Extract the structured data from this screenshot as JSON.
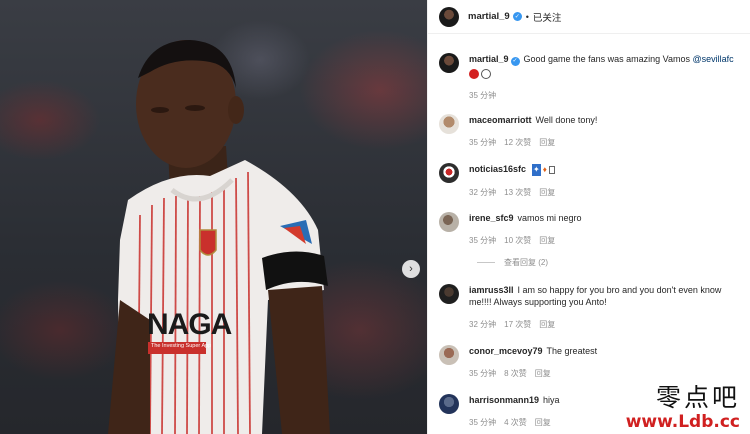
{
  "header": {
    "username": "martial_9",
    "separator": "•",
    "follow_status": "已关注"
  },
  "caption": {
    "username": "martial_9",
    "text": "Good game the fans was amazing Vamos",
    "mention": "@sevillafc",
    "time": "35 分钟"
  },
  "comments": [
    {
      "username": "maceomarriott",
      "text": "Well done tony!",
      "time": "35 分钟",
      "likes": "12 次赞",
      "reply": "回复"
    },
    {
      "username": "noticias16sfc",
      "text": "",
      "time": "32 分钟",
      "likes": "13 次赞",
      "reply": "回复"
    },
    {
      "username": "irene_sfc9",
      "text": "vamos mi negro",
      "time": "35 分钟",
      "likes": "10 次赞",
      "reply": "回复"
    },
    {
      "username": "iamruss3ll",
      "text": "I am so happy for you bro and you don't even know me!!!! Always supporting you Anto!",
      "time": "32 分钟",
      "likes": "17 次赞",
      "reply": "回复"
    },
    {
      "username": "conor_mcevoy79",
      "text": "The greatest",
      "time": "35 分钟",
      "likes": "8 次赞",
      "reply": "回复"
    },
    {
      "username": "harrisonmann19",
      "text": "hiya",
      "time": "35 分钟",
      "likes": "4 次赞",
      "reply": "回复"
    }
  ],
  "view_replies": "查看回复 (2)",
  "photo": {
    "sponsor": "NAGA",
    "sponsor_tagline": "The Investing Super App"
  },
  "watermark": {
    "chinese": "零点吧",
    "url": "www.Ldb.cc"
  },
  "colors": {
    "verified": "#3897f0",
    "link": "#00376b",
    "meta": "#8e8e8e",
    "watermark_url": "#d02020"
  }
}
